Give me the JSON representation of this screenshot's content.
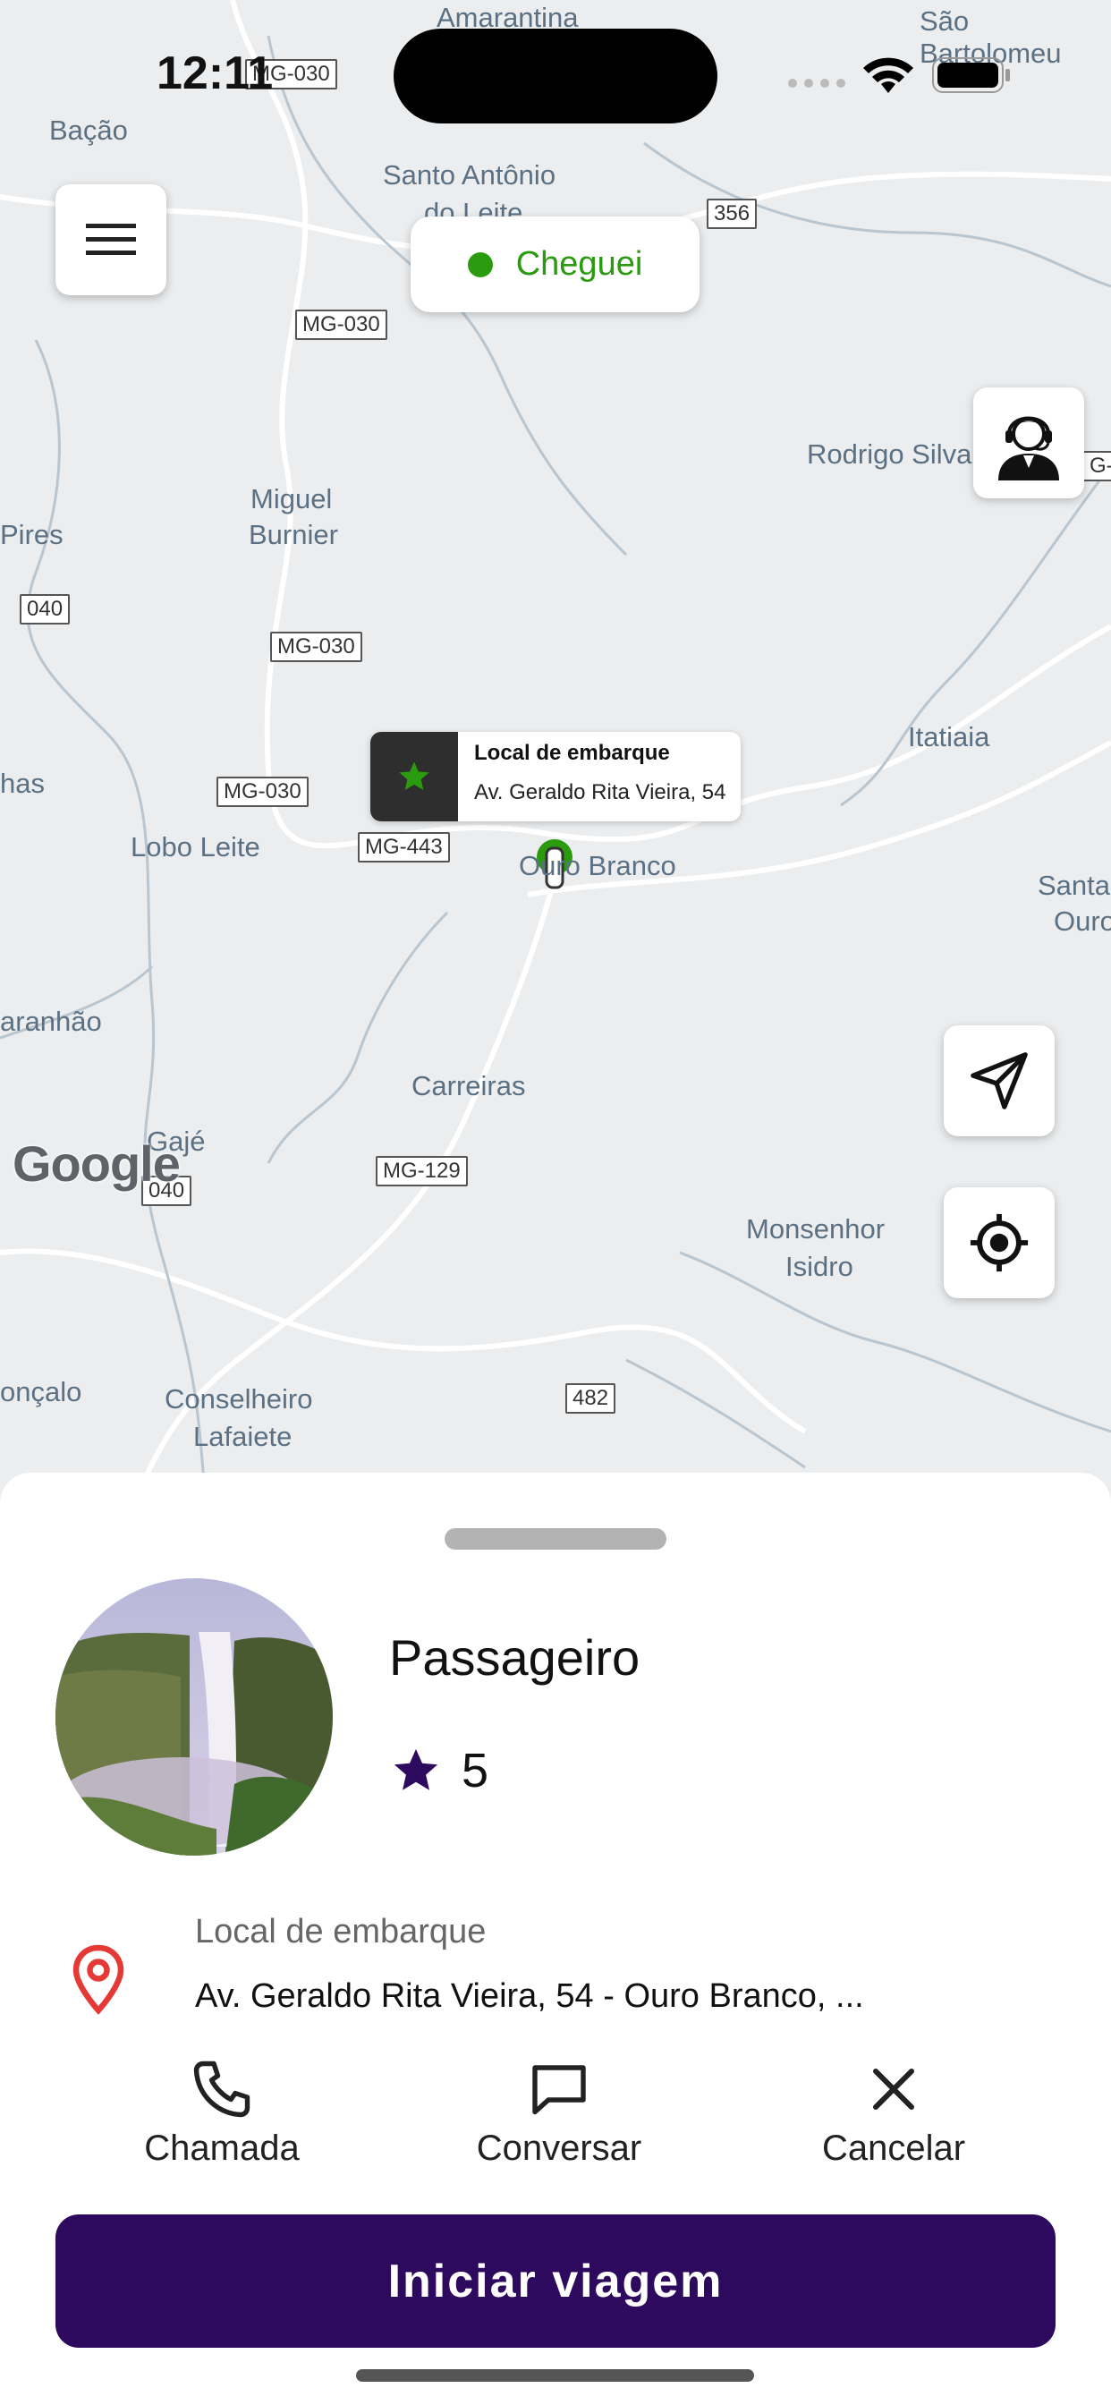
{
  "status_bar": {
    "time": "12:11"
  },
  "map": {
    "labels": [
      "Amarantina",
      "São Bartolomeu",
      "Bação",
      "Santo Antônio",
      "do Leite",
      "Rodrigo Silva",
      "Miguel",
      "Burnier",
      "Pires",
      "Itatiaia",
      "has",
      "Lobo Leite",
      "Ouro Branco",
      "Santa",
      "Ouro",
      "aranhão",
      "Carreiras",
      "Gajé",
      "Monsenhor",
      "Isidro",
      "onçalo",
      "Conselheiro",
      "Lafaiete"
    ],
    "shields": [
      "MG-030",
      "356",
      "MG-030",
      "040",
      "MG-030",
      "MG-030",
      "MG-443",
      "MG-129",
      "040",
      "482",
      "G-"
    ],
    "google": "Google"
  },
  "status_pill": {
    "label": "Cheguei",
    "color": "#2a9b0e"
  },
  "pickup_tooltip": {
    "title": "Local de embarque",
    "address": "Av. Geraldo Rita Vieira, 54"
  },
  "passenger": {
    "name": "Passageiro",
    "rating": "5"
  },
  "pickup": {
    "label": "Local de embarque",
    "address": "Av. Geraldo Rita Vieira, 54 - Ouro Branco, ..."
  },
  "actions": {
    "call": "Chamada",
    "chat": "Conversar",
    "cancel": "Cancelar"
  },
  "cta": {
    "label": "Iniciar viagem",
    "color": "#2d0a5e"
  },
  "icons": [
    "menu-icon",
    "support-agent-icon",
    "navigation-arrow-icon",
    "my-location-icon",
    "star-icon",
    "car-icon",
    "location-pin-icon",
    "phone-icon",
    "chat-icon",
    "close-icon"
  ]
}
